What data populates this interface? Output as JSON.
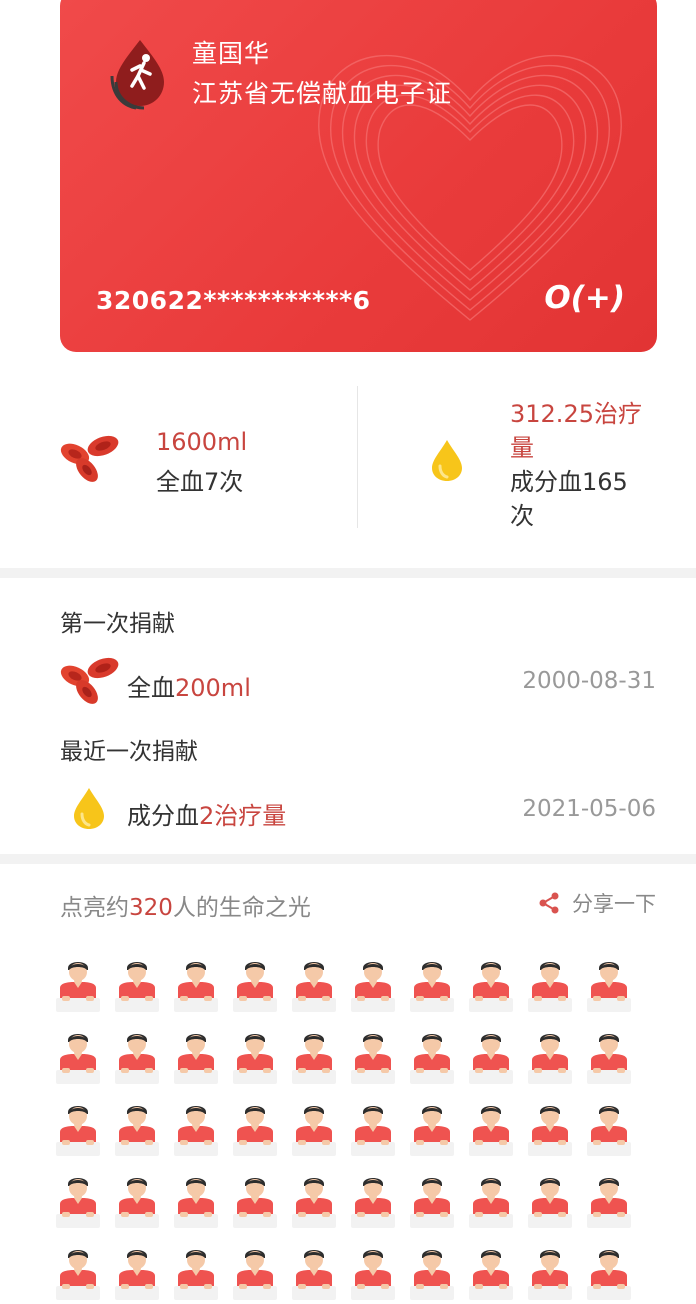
{
  "card": {
    "name": "童国华",
    "title": "江苏省无偿献血电子证",
    "id_number": "320622***********6",
    "blood_type": "O(+)"
  },
  "stats": {
    "whole_blood": {
      "amount": "1600ml",
      "label": "全血7次",
      "icon": "red-blood-cells-icon"
    },
    "component": {
      "amount_line1": "312.25治疗",
      "amount_line2": "量",
      "label_line1": "成分血165",
      "label_line2": "次",
      "icon": "yellow-drop-icon"
    }
  },
  "history": {
    "first_title": "第一次捐献",
    "first": {
      "type": "全血",
      "amount": "200ml",
      "date": "2000-08-31"
    },
    "latest_title": "最近一次捐献",
    "latest": {
      "type": "成分血",
      "amount": "2治疗量",
      "date": "2021-05-06"
    }
  },
  "people": {
    "title_prefix": "点亮约",
    "count": "320",
    "title_suffix": "人的生命之光",
    "share_label": "分享一下",
    "share_icon": "share-icon",
    "person_icon": "person-icon"
  },
  "colors": {
    "card_red": "#e93b3b",
    "accent_red": "#c8453f",
    "drop_yellow": "#f7c51a"
  }
}
